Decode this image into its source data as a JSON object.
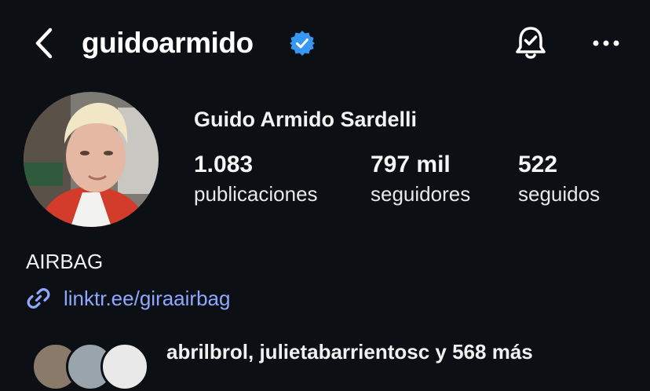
{
  "header": {
    "username": "guidoarmido",
    "icons": {
      "back": "chevron-left-icon",
      "verified": "verified-badge-icon",
      "notifications": "bell-icon",
      "more": "more-horizontal-icon"
    }
  },
  "profile": {
    "full_name": "Guido Armido Sardelli",
    "stats": [
      {
        "value": "1.083",
        "label": "publicaciones"
      },
      {
        "value": "797 mil",
        "label": "seguidores"
      },
      {
        "value": "522",
        "label": "seguidos"
      }
    ],
    "bio_name": "AIRBAG",
    "link": "linktr.ee/giraairbag"
  },
  "followed_by": {
    "text": "abrilbrol, julietabarrientosc y 568 más"
  },
  "colors": {
    "background": "#0c0f14",
    "verified": "#3897f0",
    "link": "#8fa8ff"
  }
}
